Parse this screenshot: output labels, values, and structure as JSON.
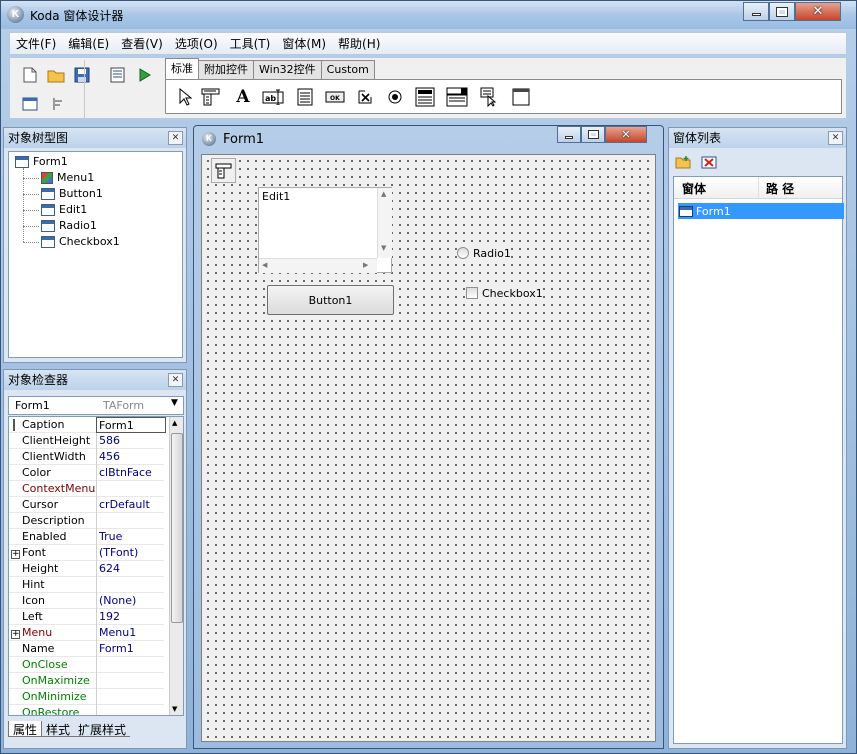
{
  "app": {
    "title": "Koda 窗体设计器",
    "icon_letter": "K"
  },
  "menu": [
    "文件(F)",
    "编辑(E)",
    "查看(V)",
    "选项(O)",
    "工具(T)",
    "窗体(M)",
    "帮助(H)"
  ],
  "palette_tabs": [
    "标准",
    "附加控件",
    "Win32控件",
    "Custom"
  ],
  "palette_icons": [
    "pointer-icon",
    "menu-tool-icon",
    "label-tool-icon",
    "edit-tool-icon",
    "memo-tool-icon",
    "button-tool-icon",
    "checkbox-tool-icon",
    "radio-tool-icon",
    "groupbox-tool-icon",
    "combobox-tool-icon",
    "listbox-tool-icon",
    "panel-tool-icon"
  ],
  "tree_panel": {
    "title": "对象树型图",
    "root": "Form1",
    "children": [
      "Menu1",
      "Button1",
      "Edit1",
      "Radio1",
      "Checkbox1"
    ]
  },
  "form": {
    "title": "Form1",
    "edit_text": "Edit1",
    "button_text": "Button1",
    "radio_text": "Radio1",
    "checkbox_text": "Checkbox1"
  },
  "inspector": {
    "title": "对象检查器",
    "object_name": "Form1",
    "object_type": "TAForm",
    "rows": [
      {
        "name": "Caption",
        "value": "Form1",
        "color": "#000000"
      },
      {
        "name": "ClientHeight",
        "value": "586",
        "color": "#000000"
      },
      {
        "name": "ClientWidth",
        "value": "456",
        "color": "#000000"
      },
      {
        "name": "Color",
        "value": "clBtnFace",
        "color": "#000000"
      },
      {
        "name": "ContextMenu",
        "value": "",
        "color": "#800000"
      },
      {
        "name": "Cursor",
        "value": "crDefault",
        "color": "#000000"
      },
      {
        "name": "Description",
        "value": "",
        "color": "#000000"
      },
      {
        "name": "Enabled",
        "value": "True",
        "color": "#000000"
      },
      {
        "name": "Font",
        "value": "(TFont)",
        "color": "#000000",
        "expandable": true
      },
      {
        "name": "Height",
        "value": "624",
        "color": "#000000"
      },
      {
        "name": "Hint",
        "value": "",
        "color": "#000000"
      },
      {
        "name": "Icon",
        "value": "(None)",
        "color": "#000000"
      },
      {
        "name": "Left",
        "value": "192",
        "color": "#000000"
      },
      {
        "name": "Menu",
        "value": "Menu1",
        "color": "#800000",
        "expandable": true
      },
      {
        "name": "Name",
        "value": "Form1",
        "color": "#000000"
      },
      {
        "name": "OnClose",
        "value": "",
        "color": "#008000"
      },
      {
        "name": "OnMaximize",
        "value": "",
        "color": "#008000"
      },
      {
        "name": "OnMinimize",
        "value": "",
        "color": "#008000"
      },
      {
        "name": "OnRestore",
        "value": "",
        "color": "#008000"
      }
    ],
    "tabs": [
      "属性",
      "样式",
      "扩展样式"
    ]
  },
  "form_list": {
    "title": "窗体列表",
    "columns": [
      "窗体",
      "路 径"
    ],
    "items": [
      {
        "name": "Form1",
        "path": ""
      }
    ]
  }
}
